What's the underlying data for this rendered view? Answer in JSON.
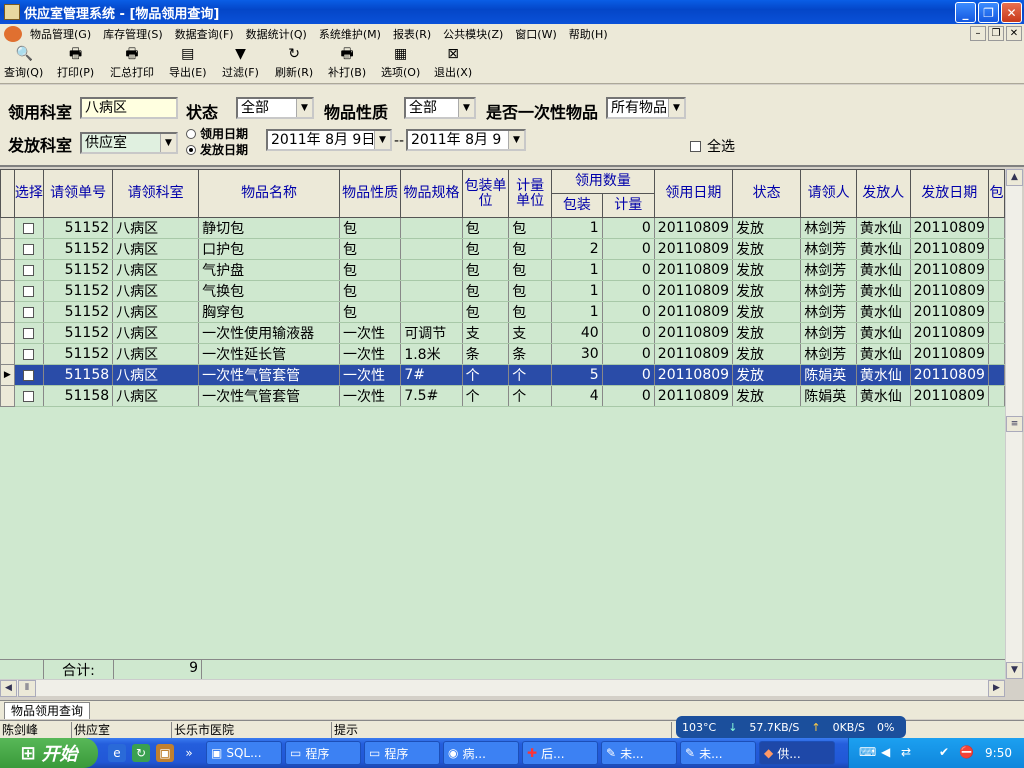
{
  "window": {
    "title": "供应室管理系统 - [物品领用查询]"
  },
  "menu": [
    "物品管理(G)",
    "库存管理(S)",
    "数据查询(F)",
    "数据统计(Q)",
    "系统维护(M)",
    "报表(R)",
    "公共模块(Z)",
    "窗口(W)",
    "帮助(H)"
  ],
  "toolbar": [
    {
      "label": "查询(Q)",
      "icon": "magnifier-icon"
    },
    {
      "label": "打印(P)",
      "icon": "printer-icon"
    },
    {
      "label": "汇总打印",
      "icon": "printer-icon"
    },
    {
      "label": "导出(E)",
      "icon": "export-icon"
    },
    {
      "label": "过滤(F)",
      "icon": "filter-icon"
    },
    {
      "label": "刷新(R)",
      "icon": "refresh-icon"
    },
    {
      "label": "补打(B)",
      "icon": "printer-icon"
    },
    {
      "label": "选项(O)",
      "icon": "options-icon"
    },
    {
      "label": "退出(X)",
      "icon": "exit-icon"
    }
  ],
  "filter": {
    "dept_label": "领用科室",
    "dept_value": "八病区",
    "status_label": "状态",
    "status_value": "全部",
    "nature_label": "物品性质",
    "nature_value": "全部",
    "disposable_label": "是否一次性物品",
    "disposable_value": "所有物品",
    "issue_label": "发放科室",
    "issue_value": "供应室",
    "radio_use": "领用日期",
    "radio_issue": "发放日期",
    "date_from": "2011年 8月 9日",
    "date_sep": "--",
    "date_to": "2011年 8月 9",
    "select_all": "全选"
  },
  "columns": {
    "select": "选择",
    "req_no": "请领单号",
    "req_dept": "请领科室",
    "item_name": "物品名称",
    "nature": "物品性质",
    "spec": "物品规格",
    "pack_unit": "包装单位",
    "measure_unit": "计量单位",
    "qty_group": "领用数量",
    "qty_pack": "包装",
    "qty_measure": "计量",
    "use_date": "领用日期",
    "status": "状态",
    "requester": "请领人",
    "issuer": "发放人",
    "issue_date": "发放日期",
    "extra": "包"
  },
  "rows": [
    {
      "no": "51152",
      "dept": "八病区",
      "name": "静切包",
      "nature": "包",
      "spec": "",
      "pack": "包",
      "unit": "包",
      "qp": "1",
      "qm": "0",
      "date": "20110809",
      "status": "发放",
      "req": "林剑芳",
      "iss": "黄水仙",
      "idate": "20110809"
    },
    {
      "no": "51152",
      "dept": "八病区",
      "name": "口护包",
      "nature": "包",
      "spec": "",
      "pack": "包",
      "unit": "包",
      "qp": "2",
      "qm": "0",
      "date": "20110809",
      "status": "发放",
      "req": "林剑芳",
      "iss": "黄水仙",
      "idate": "20110809"
    },
    {
      "no": "51152",
      "dept": "八病区",
      "name": "气护盘",
      "nature": "包",
      "spec": "",
      "pack": "包",
      "unit": "包",
      "qp": "1",
      "qm": "0",
      "date": "20110809",
      "status": "发放",
      "req": "林剑芳",
      "iss": "黄水仙",
      "idate": "20110809"
    },
    {
      "no": "51152",
      "dept": "八病区",
      "name": "气换包",
      "nature": "包",
      "spec": "",
      "pack": "包",
      "unit": "包",
      "qp": "1",
      "qm": "0",
      "date": "20110809",
      "status": "发放",
      "req": "林剑芳",
      "iss": "黄水仙",
      "idate": "20110809"
    },
    {
      "no": "51152",
      "dept": "八病区",
      "name": "胸穿包",
      "nature": "包",
      "spec": "",
      "pack": "包",
      "unit": "包",
      "qp": "1",
      "qm": "0",
      "date": "20110809",
      "status": "发放",
      "req": "林剑芳",
      "iss": "黄水仙",
      "idate": "20110809"
    },
    {
      "no": "51152",
      "dept": "八病区",
      "name": "一次性使用输液器",
      "nature": "一次性",
      "spec": "可调节",
      "pack": "支",
      "unit": "支",
      "qp": "40",
      "qm": "0",
      "date": "20110809",
      "status": "发放",
      "req": "林剑芳",
      "iss": "黄水仙",
      "idate": "20110809"
    },
    {
      "no": "51152",
      "dept": "八病区",
      "name": "一次性延长管",
      "nature": "一次性",
      "spec": "1.8米",
      "pack": "条",
      "unit": "条",
      "qp": "30",
      "qm": "0",
      "date": "20110809",
      "status": "发放",
      "req": "林剑芳",
      "iss": "黄水仙",
      "idate": "20110809"
    },
    {
      "no": "51158",
      "dept": "八病区",
      "name": "一次性气管套管",
      "nature": "一次性",
      "spec": "7#",
      "pack": "个",
      "unit": "个",
      "qp": "5",
      "qm": "0",
      "date": "20110809",
      "status": "发放",
      "req": "陈娟英",
      "iss": "黄水仙",
      "idate": "20110809"
    },
    {
      "no": "51158",
      "dept": "八病区",
      "name": "一次性气管套管",
      "nature": "一次性",
      "spec": "7.5#",
      "pack": "个",
      "unit": "个",
      "qp": "4",
      "qm": "0",
      "date": "20110809",
      "status": "发放",
      "req": "陈娟英",
      "iss": "黄水仙",
      "idate": "20110809"
    }
  ],
  "total": {
    "label": "合计:",
    "count": "9"
  },
  "tab": "物品领用查询",
  "status": {
    "user": "陈剑峰",
    "dept": "供应室",
    "hospital": "长乐市医院",
    "hint": "提示"
  },
  "net": {
    "temp": "103°C",
    "down": "57.7KB/S",
    "up": "0KB/S",
    "pct": "0%"
  },
  "taskbar": {
    "start": "开始",
    "tasks": [
      "SQL...",
      "程序",
      "程序",
      "病...",
      "后...",
      "未...",
      "未...",
      "供..."
    ],
    "clock": "9:50"
  }
}
